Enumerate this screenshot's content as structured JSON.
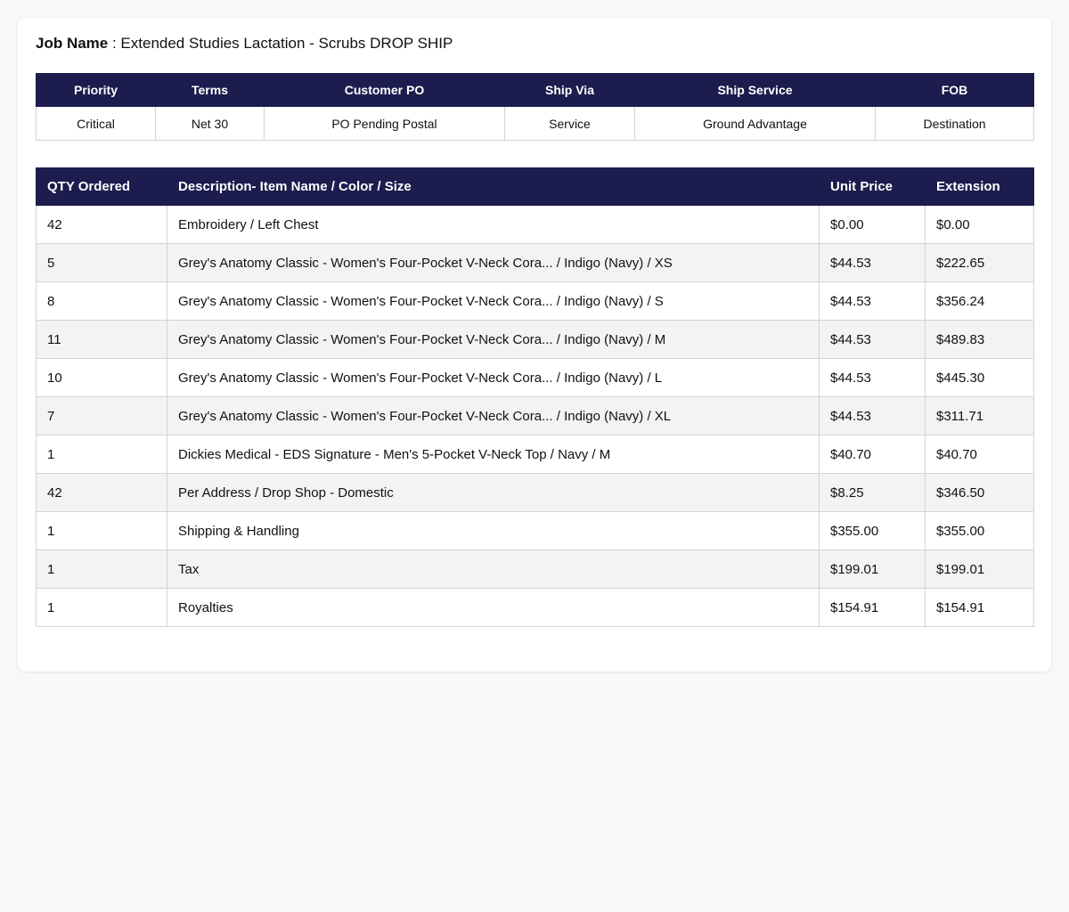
{
  "job": {
    "label": "Job Name",
    "separator": " : ",
    "value": "Extended Studies Lactation - Scrubs DROP SHIP"
  },
  "info": {
    "headers": [
      "Priority",
      "Terms",
      "Customer PO",
      "Ship Via",
      "Ship Service",
      "FOB"
    ],
    "values": [
      "Critical",
      "Net 30",
      "PO Pending Postal",
      "Service",
      "Ground Advantage",
      "Destination"
    ]
  },
  "items": {
    "headers": [
      "QTY Ordered",
      "Description- Item Name / Color / Size",
      "Unit Price",
      "Extension"
    ],
    "rows": [
      {
        "qty": "42",
        "desc": "Embroidery / Left Chest",
        "unit": "$0.00",
        "ext": "$0.00"
      },
      {
        "qty": "5",
        "desc": "Grey's Anatomy Classic - Women's Four-Pocket V-Neck Cora... / Indigo (Navy) / XS",
        "unit": "$44.53",
        "ext": "$222.65"
      },
      {
        "qty": "8",
        "desc": "Grey's Anatomy Classic - Women's Four-Pocket V-Neck Cora... / Indigo (Navy) / S",
        "unit": "$44.53",
        "ext": "$356.24"
      },
      {
        "qty": "11",
        "desc": "Grey's Anatomy Classic - Women's Four-Pocket V-Neck Cora... / Indigo (Navy) / M",
        "unit": "$44.53",
        "ext": "$489.83"
      },
      {
        "qty": "10",
        "desc": "Grey's Anatomy Classic - Women's Four-Pocket V-Neck Cora... / Indigo (Navy) / L",
        "unit": "$44.53",
        "ext": "$445.30"
      },
      {
        "qty": "7",
        "desc": "Grey's Anatomy Classic - Women's Four-Pocket V-Neck Cora... / Indigo (Navy) / XL",
        "unit": "$44.53",
        "ext": "$311.71"
      },
      {
        "qty": "1",
        "desc": "Dickies Medical - EDS Signature - Men's 5-Pocket V-Neck Top / Navy / M",
        "unit": "$40.70",
        "ext": "$40.70"
      },
      {
        "qty": "42",
        "desc": "Per Address / Drop Shop - Domestic",
        "unit": "$8.25",
        "ext": "$346.50"
      },
      {
        "qty": "1",
        "desc": "Shipping & Handling",
        "unit": "$355.00",
        "ext": "$355.00"
      },
      {
        "qty": "1",
        "desc": "Tax",
        "unit": "$199.01",
        "ext": "$199.01"
      },
      {
        "qty": "1",
        "desc": "Royalties",
        "unit": "$154.91",
        "ext": "$154.91"
      }
    ]
  },
  "colors": {
    "header_bg": "#1c1c4e",
    "header_text": "#ffffff",
    "stripe": "#f3f3f3",
    "border": "#d4d4d4"
  }
}
